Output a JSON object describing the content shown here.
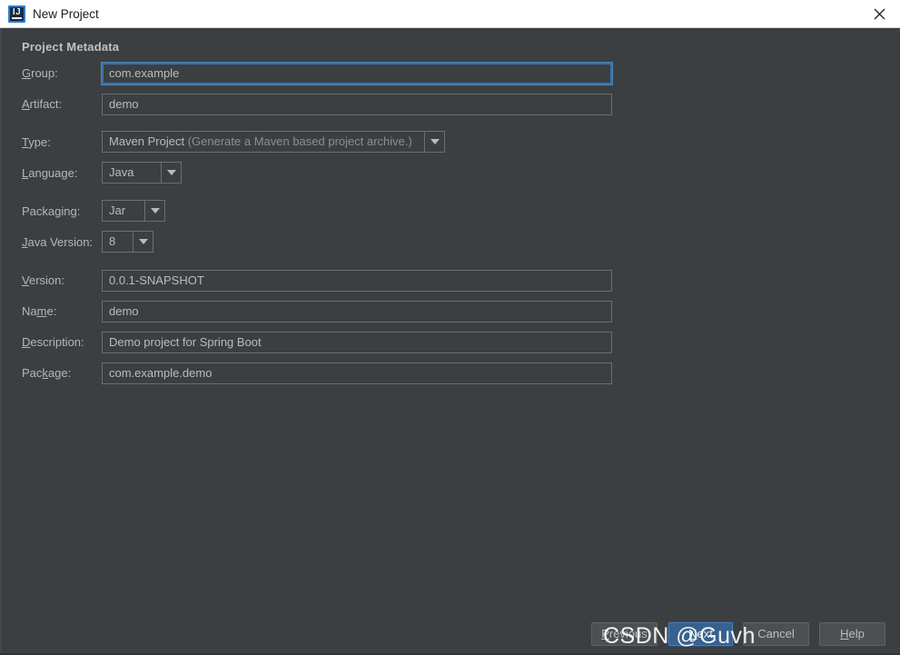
{
  "window": {
    "title": "New Project",
    "app_icon": "intellij-idea-icon",
    "icon_letters": "IJ",
    "close_icon": "close-icon"
  },
  "form": {
    "section_title": "Project Metadata",
    "fields": {
      "group": {
        "label_pre": "",
        "label_mn": "G",
        "label_post": "roup:",
        "value": "com.example",
        "focused": true
      },
      "artifact": {
        "label_pre": "",
        "label_mn": "A",
        "label_post": "rtifact:",
        "value": "demo"
      },
      "type": {
        "label_pre": "",
        "label_mn": "T",
        "label_post": "ype:",
        "value": "Maven Project",
        "value_hint": " (Generate a Maven based project archive.)"
      },
      "language": {
        "label_pre": "",
        "label_mn": "L",
        "label_post": "anguage:",
        "value": "Java"
      },
      "packaging": {
        "label_pre": "Packa",
        "label_mn": "g",
        "label_post": "ing:",
        "value": "Jar"
      },
      "java_version": {
        "label_pre": "",
        "label_mn": "J",
        "label_post": "ava Version:",
        "value": "8"
      },
      "version": {
        "label_pre": "",
        "label_mn": "V",
        "label_post": "ersion:",
        "value": "0.0.1-SNAPSHOT"
      },
      "name": {
        "label_pre": "Na",
        "label_mn": "m",
        "label_post": "e:",
        "value": "demo"
      },
      "description": {
        "label_pre": "",
        "label_mn": "D",
        "label_post": "escription:",
        "value": "Demo project for Spring Boot"
      },
      "package": {
        "label_pre": "Pac",
        "label_mn": "k",
        "label_post": "age:",
        "value": "com.example.demo"
      }
    }
  },
  "buttons": {
    "previous": {
      "pre": "",
      "mn": "P",
      "post": "revious"
    },
    "next": {
      "pre": "",
      "mn": "N",
      "post": "ext"
    },
    "cancel": {
      "pre": "Cancel",
      "mn": "",
      "post": ""
    },
    "help": {
      "pre": "",
      "mn": "H",
      "post": "elp"
    }
  },
  "watermark": {
    "text": "CSDN @Guvh"
  },
  "colors": {
    "panel_bg": "#3c3f41",
    "titlebar_bg": "#ffffff",
    "label_fg": "#b4b7ba",
    "field_border": "#6b6f72",
    "focus_border": "#3d72ab",
    "primary_button_bg": "#37618e"
  }
}
